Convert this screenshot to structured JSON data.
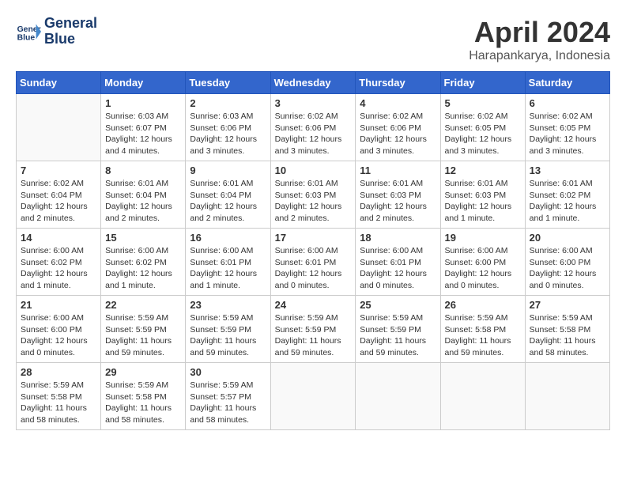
{
  "header": {
    "logo_line1": "General",
    "logo_line2": "Blue",
    "month": "April 2024",
    "location": "Harapankarya, Indonesia"
  },
  "weekdays": [
    "Sunday",
    "Monday",
    "Tuesday",
    "Wednesday",
    "Thursday",
    "Friday",
    "Saturday"
  ],
  "weeks": [
    [
      {
        "day": "",
        "info": ""
      },
      {
        "day": "1",
        "info": "Sunrise: 6:03 AM\nSunset: 6:07 PM\nDaylight: 12 hours\nand 4 minutes."
      },
      {
        "day": "2",
        "info": "Sunrise: 6:03 AM\nSunset: 6:06 PM\nDaylight: 12 hours\nand 3 minutes."
      },
      {
        "day": "3",
        "info": "Sunrise: 6:02 AM\nSunset: 6:06 PM\nDaylight: 12 hours\nand 3 minutes."
      },
      {
        "day": "4",
        "info": "Sunrise: 6:02 AM\nSunset: 6:06 PM\nDaylight: 12 hours\nand 3 minutes."
      },
      {
        "day": "5",
        "info": "Sunrise: 6:02 AM\nSunset: 6:05 PM\nDaylight: 12 hours\nand 3 minutes."
      },
      {
        "day": "6",
        "info": "Sunrise: 6:02 AM\nSunset: 6:05 PM\nDaylight: 12 hours\nand 3 minutes."
      }
    ],
    [
      {
        "day": "7",
        "info": "Sunrise: 6:02 AM\nSunset: 6:04 PM\nDaylight: 12 hours\nand 2 minutes."
      },
      {
        "day": "8",
        "info": "Sunrise: 6:01 AM\nSunset: 6:04 PM\nDaylight: 12 hours\nand 2 minutes."
      },
      {
        "day": "9",
        "info": "Sunrise: 6:01 AM\nSunset: 6:04 PM\nDaylight: 12 hours\nand 2 minutes."
      },
      {
        "day": "10",
        "info": "Sunrise: 6:01 AM\nSunset: 6:03 PM\nDaylight: 12 hours\nand 2 minutes."
      },
      {
        "day": "11",
        "info": "Sunrise: 6:01 AM\nSunset: 6:03 PM\nDaylight: 12 hours\nand 2 minutes."
      },
      {
        "day": "12",
        "info": "Sunrise: 6:01 AM\nSunset: 6:03 PM\nDaylight: 12 hours\nand 1 minute."
      },
      {
        "day": "13",
        "info": "Sunrise: 6:01 AM\nSunset: 6:02 PM\nDaylight: 12 hours\nand 1 minute."
      }
    ],
    [
      {
        "day": "14",
        "info": "Sunrise: 6:00 AM\nSunset: 6:02 PM\nDaylight: 12 hours\nand 1 minute."
      },
      {
        "day": "15",
        "info": "Sunrise: 6:00 AM\nSunset: 6:02 PM\nDaylight: 12 hours\nand 1 minute."
      },
      {
        "day": "16",
        "info": "Sunrise: 6:00 AM\nSunset: 6:01 PM\nDaylight: 12 hours\nand 1 minute."
      },
      {
        "day": "17",
        "info": "Sunrise: 6:00 AM\nSunset: 6:01 PM\nDaylight: 12 hours\nand 0 minutes."
      },
      {
        "day": "18",
        "info": "Sunrise: 6:00 AM\nSunset: 6:01 PM\nDaylight: 12 hours\nand 0 minutes."
      },
      {
        "day": "19",
        "info": "Sunrise: 6:00 AM\nSunset: 6:00 PM\nDaylight: 12 hours\nand 0 minutes."
      },
      {
        "day": "20",
        "info": "Sunrise: 6:00 AM\nSunset: 6:00 PM\nDaylight: 12 hours\nand 0 minutes."
      }
    ],
    [
      {
        "day": "21",
        "info": "Sunrise: 6:00 AM\nSunset: 6:00 PM\nDaylight: 12 hours\nand 0 minutes."
      },
      {
        "day": "22",
        "info": "Sunrise: 5:59 AM\nSunset: 5:59 PM\nDaylight: 11 hours\nand 59 minutes."
      },
      {
        "day": "23",
        "info": "Sunrise: 5:59 AM\nSunset: 5:59 PM\nDaylight: 11 hours\nand 59 minutes."
      },
      {
        "day": "24",
        "info": "Sunrise: 5:59 AM\nSunset: 5:59 PM\nDaylight: 11 hours\nand 59 minutes."
      },
      {
        "day": "25",
        "info": "Sunrise: 5:59 AM\nSunset: 5:59 PM\nDaylight: 11 hours\nand 59 minutes."
      },
      {
        "day": "26",
        "info": "Sunrise: 5:59 AM\nSunset: 5:58 PM\nDaylight: 11 hours\nand 59 minutes."
      },
      {
        "day": "27",
        "info": "Sunrise: 5:59 AM\nSunset: 5:58 PM\nDaylight: 11 hours\nand 58 minutes."
      }
    ],
    [
      {
        "day": "28",
        "info": "Sunrise: 5:59 AM\nSunset: 5:58 PM\nDaylight: 11 hours\nand 58 minutes."
      },
      {
        "day": "29",
        "info": "Sunrise: 5:59 AM\nSunset: 5:58 PM\nDaylight: 11 hours\nand 58 minutes."
      },
      {
        "day": "30",
        "info": "Sunrise: 5:59 AM\nSunset: 5:57 PM\nDaylight: 11 hours\nand 58 minutes."
      },
      {
        "day": "",
        "info": ""
      },
      {
        "day": "",
        "info": ""
      },
      {
        "day": "",
        "info": ""
      },
      {
        "day": "",
        "info": ""
      }
    ]
  ]
}
